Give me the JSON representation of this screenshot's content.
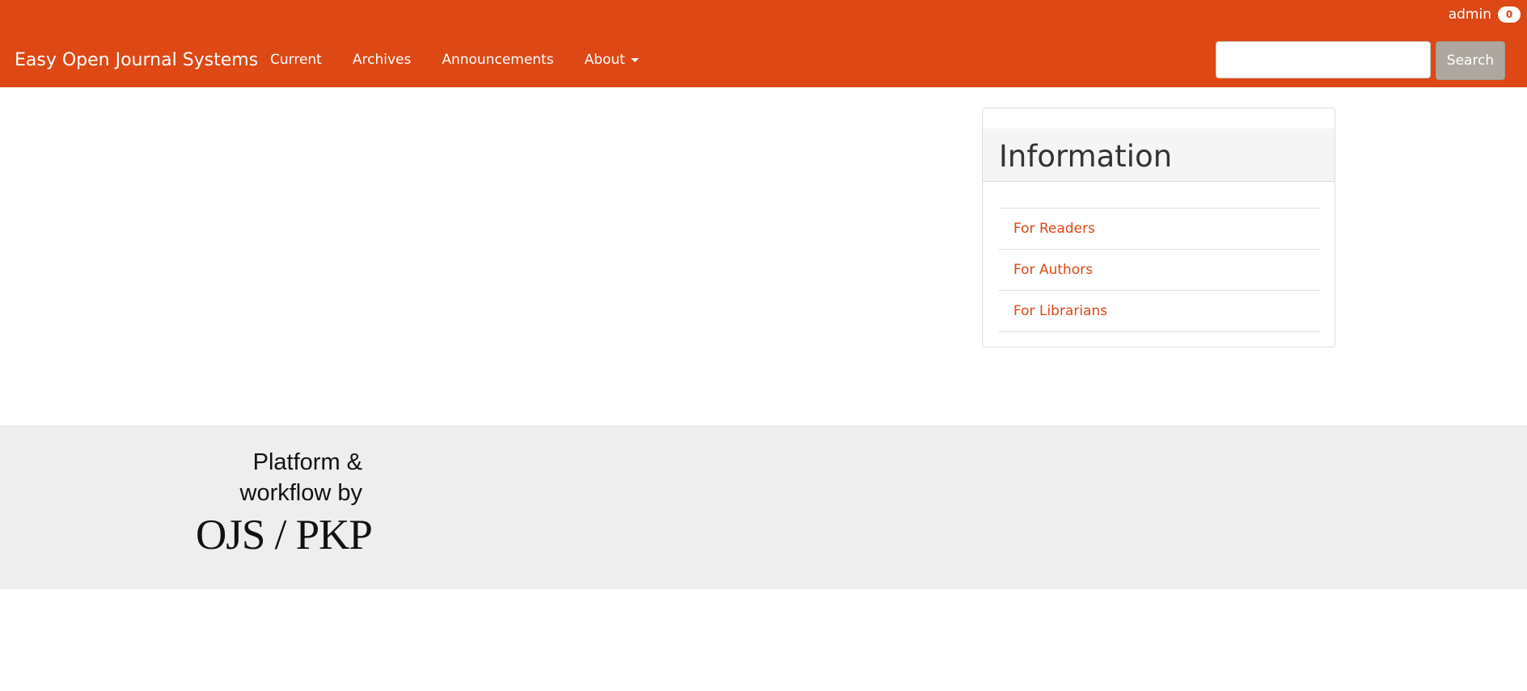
{
  "header": {
    "brand": "Easy Open Journal Systems",
    "user": "admin",
    "notification_count": "0",
    "nav": [
      {
        "label": "Current"
      },
      {
        "label": "Archives"
      },
      {
        "label": "Announcements"
      },
      {
        "label": "About"
      }
    ],
    "search": {
      "value": "",
      "placeholder": "",
      "button_label": "Search"
    }
  },
  "sidebar": {
    "block_title": "Information",
    "links": [
      {
        "label": "For Readers"
      },
      {
        "label": "For Authors"
      },
      {
        "label": "For Librarians"
      }
    ]
  },
  "footer": {
    "logo_line1": "Platform &",
    "logo_line2": "workflow by",
    "logo_line3": "OJS / PKP"
  },
  "colors": {
    "brand": "#dd4814",
    "search_button": "#aea79f",
    "footer_bg": "#eeeeee",
    "panel_heading": "#f5f5f5"
  },
  "icons": {
    "about_dropdown": "caret-down-icon"
  }
}
